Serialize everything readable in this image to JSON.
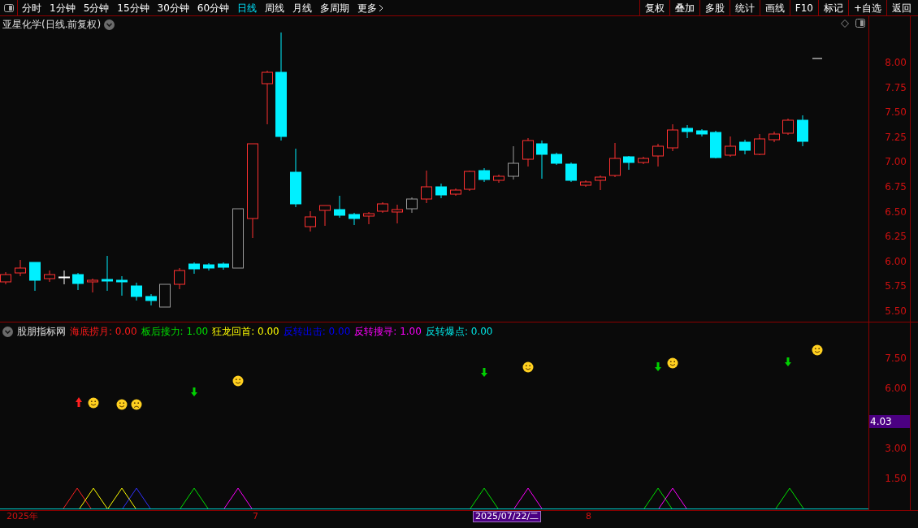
{
  "toolbar": {
    "periods": [
      {
        "label": "分时",
        "selected": false
      },
      {
        "label": "1分钟",
        "selected": false
      },
      {
        "label": "5分钟",
        "selected": false
      },
      {
        "label": "15分钟",
        "selected": false
      },
      {
        "label": "30分钟",
        "selected": false
      },
      {
        "label": "60分钟",
        "selected": false
      },
      {
        "label": "日线",
        "selected": true
      },
      {
        "label": "周线",
        "selected": false
      },
      {
        "label": "月线",
        "selected": false
      },
      {
        "label": "多周期",
        "selected": false
      }
    ],
    "more": "更多",
    "right_buttons": [
      "复权",
      "叠加",
      "多股",
      "统计",
      "画线",
      "F10",
      "标记",
      "+自选",
      "返回"
    ]
  },
  "main_chart": {
    "title": "亚星化学(日线.前复权)",
    "y_axis": [
      "8.00",
      "7.75",
      "7.50",
      "7.25",
      "7.00",
      "6.75",
      "6.50",
      "6.25",
      "6.00",
      "5.75",
      "5.50"
    ]
  },
  "indicator": {
    "name": "股朋指标网",
    "values": [
      {
        "text": "海底捞月: 0.00",
        "color": "#ff1a1a"
      },
      {
        "text": "板后接力: 1.00",
        "color": "#00e000"
      },
      {
        "text": "狂龙回首: 0.00",
        "color": "#ffff00"
      },
      {
        "text": "反转出击: 0.00",
        "color": "#0000ff"
      },
      {
        "text": "反转搜寻: 1.00",
        "color": "#ff00ff"
      },
      {
        "text": "反转爆点: 0.00",
        "color": "#00e5e5"
      }
    ],
    "y_axis": [
      "7.50",
      "6.00",
      "3.00",
      "1.50"
    ],
    "cursor_value": "4.03"
  },
  "time_axis": {
    "labels": [
      "2025年",
      "7",
      "8"
    ],
    "cursor_date": "2025/07/22/二"
  }
}
